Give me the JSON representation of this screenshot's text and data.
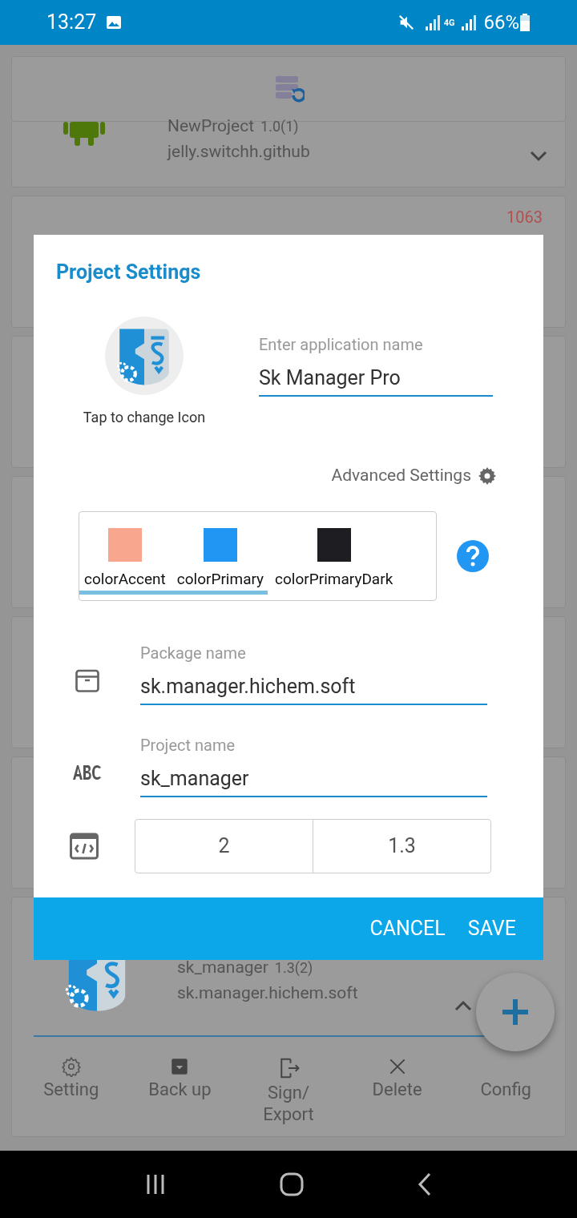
{
  "status_bar": {
    "time": "13:27",
    "network": "4G",
    "battery": "66%"
  },
  "background": {
    "project_card": {
      "name": "NewProject",
      "version": "1.0(1)",
      "package": "jelly.switchh.github"
    },
    "badge": "1063",
    "current_card": {
      "name": "sk_manager",
      "version": "1.3(2)",
      "package": "sk.manager.hichem.soft"
    },
    "actions": [
      {
        "label": "Setting",
        "kind": "gear"
      },
      {
        "label": "Back up",
        "kind": "archive"
      },
      {
        "label": "Sign/\nExport",
        "kind": "export"
      },
      {
        "label": "Delete",
        "kind": "close"
      },
      {
        "label": "Config",
        "kind": "none"
      }
    ]
  },
  "dialog": {
    "title": "Project Settings",
    "icon_caption": "Tap to change Icon",
    "app_name": {
      "placeholder": "Enter application name",
      "value": "Sk Manager Pro"
    },
    "advanced": "Advanced Settings",
    "colors": [
      {
        "name": "colorAccent",
        "color": "#f9a68f"
      },
      {
        "name": "colorPrimary",
        "color": "#2196f3"
      },
      {
        "name": "colorPrimaryDark",
        "color": "#1e1e22"
      }
    ],
    "fields": [
      {
        "kind": "package",
        "placeholder": "Package name",
        "value": "sk.manager.hichem.soft"
      },
      {
        "kind": "abc",
        "placeholder": "Project name",
        "value": "sk_manager"
      }
    ],
    "versions": [
      {
        "value": "2"
      },
      {
        "value": "1.3"
      }
    ],
    "buttons": [
      "CANCEL",
      "SAVE"
    ]
  }
}
